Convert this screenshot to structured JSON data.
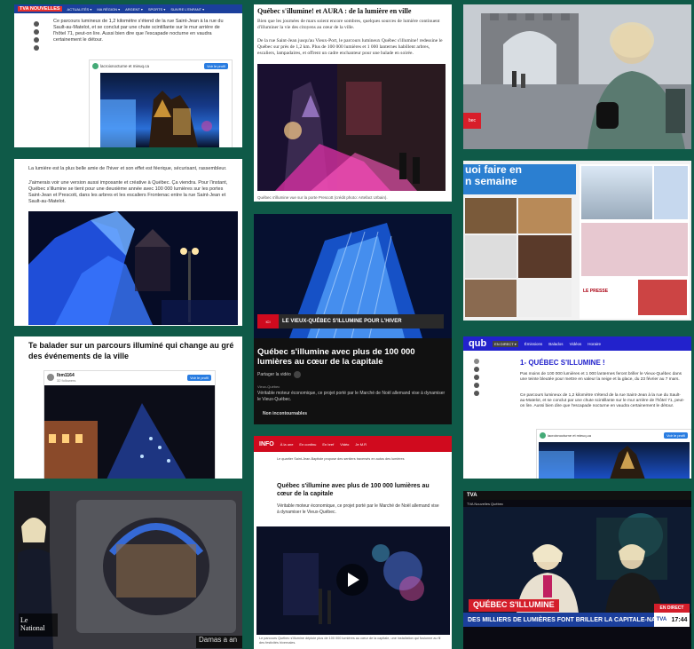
{
  "t1": {
    "brand": "TVA NOUVELLES",
    "nav": [
      "ACTUALITÉS ▾",
      "MA RÉGION ▾",
      "ARGENT ▾",
      "SPORTS ▾",
      "SUIVRE L'ENFANT ▾"
    ],
    "body": "Ce parcours lumineux de 1,2 kilomètre s'étend de la rue Saint-Jean à la rue du Sault-au-Matelot, et se conclut par une chute scintillante sur le mur arrière de l'hôtel 71, peut-on lire. Aussi bien dire que l'escapade nocturne en vaudra certainement le détour.",
    "acct": "lacroixnocturne et mieuq.ca",
    "follow": "Voir le profil"
  },
  "t2": {
    "title": "Québec s'illumine! et AURA : de la lumière en ville",
    "p1": "Bien que les journées de mars soient encore sombres, quelques sources de lumière continuent d'illuminer la vie des citoyens au cœur de la ville.",
    "p2": "De la rue Saint-Jean jusqu'au Vieux-Port, le parcours lumineux Québec s'illumine! redessine le Québec sur près de 1,2 km. Plus de 100 000 lumières et 1 000 lanternes habillent arbres, escaliers, lampadaires, et offrent un cadre enchanteur pour une balade en soirée.",
    "caption": "Québec s'illumine vue sur la porte Prescott (crédit photo: Artefact Urbain)."
  },
  "t4": {
    "p1": "La lumière est la plus belle amie de l'hiver et son effet est féerique, sécurisant, rassembleur.",
    "p2": "J'aimerais voir une version aussi imposante et créative à Québec. Ça viendra. Pour l'instant, Québec s'illumine se tient pour une deuxième année avec 100 000 lumières sur les portes Saint-Jean et Prescott, dans les arbres et les escaliers Frontenac entre la rue Saint-Jean et Sault-au-Matelot."
  },
  "t5": {
    "banner": "LE VIEUX-QUÉBEC S'ILLUMINE POUR L'HIVER",
    "title": "Québec s'illumine avec plus de 100 000 lumières au cœur de la capitale",
    "share": "Partager la vidéo",
    "meta": "Vieux-Québec",
    "body": "Véritable moteur économique, ce projet porté par le Marché de Noël allemand vise à dynamiser le Vieux-Québec.",
    "more": "Non incontournables"
  },
  "t6": {
    "headline": "uoi faire en\nn semaine",
    "brand": "LE PRESSE"
  },
  "t7": {
    "title": "Te balader sur un parcours illuminé qui change au gré des événements de la ville",
    "acct": "lbm1164",
    "followers": "32 followers",
    "follow": "Voir le profil"
  },
  "t8": {
    "brand": "qub",
    "nav": [
      "EN DIRECT ▾",
      "Émissions",
      "Balados",
      "Vidéos",
      "Horaire"
    ],
    "title": "1- QUÉBEC S'ILLUMINE !",
    "p1": "Pas moins de 100 000 lumières et 1 000 lanternes feront briller le Vieux-Québec dans une teinte bleutée pour mettre en valeur la neige et la glace, du 23 février au 7 mars.",
    "p2": "Ce parcours lumineux de 1,2 kilomètre s'étend de la rue Saint-Jean à la rue du Sault-au-Matelot, et se conclut par une chute scintillante sur le mur arrière de l'hôtel 71, peut-on lire. Aussi bien dire que l'escapade nocturne en vaudra certainement le détour.",
    "acct": "lacroixnocturne et mieuq.ca",
    "follow": "Voir le profil"
  },
  "t9": {
    "logo_line1": "Le",
    "logo_line2": "National",
    "ticker": "Damas a an"
  },
  "t10": {
    "brand": "INFO",
    "nav": [
      "À la une",
      "En continu",
      "En bref",
      "Vidéo",
      "Je M.R"
    ],
    "toptext": "Le quartier Saint-Jean-Baptiste propose des sentiers traversés en autos des lumières",
    "title": "Québec s'illumine avec plus de 100 000 lumières au cœur de la capitale",
    "body": "Véritable moteur économique, ce projet porté par le Marché de Noël allemand vise à dynamiser le Vieux-Québec.",
    "caption": "Le parcours Québec s'illumine déploie plus de 100 000 lumières au cœur de la capitale, une installation qui fusionne au fil des festivités hivernales."
  },
  "t11": {
    "brand": "TVA",
    "label": "TVA Nouvelles Québec",
    "lower_title": "QUÉBEC S'ILLUMINE",
    "lower_sub": "DES MILLIERS DE LUMIÈRES FONT BRILLER LA CAPITALE-NATIONALE",
    "live": "EN DIRECT",
    "station": "TVA",
    "time": "17:44"
  },
  "colors": {
    "background": "#0f5a48",
    "tva_blue": "#1b3f9c",
    "qub_blue": "#2222cc",
    "ici_red": "#d00a1e"
  }
}
